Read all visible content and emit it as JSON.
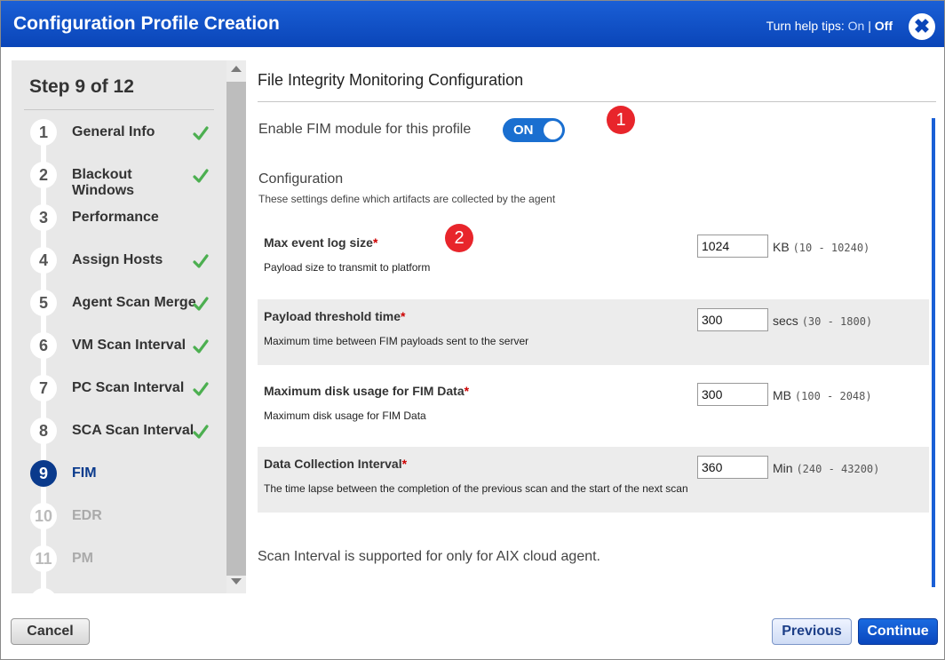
{
  "dialog": {
    "title": "Configuration Profile Creation",
    "help_prefix": "Turn help tips:",
    "help_on": "On",
    "help_sep": "|",
    "help_off": "Off",
    "close_glyph": "✖"
  },
  "sidebar": {
    "step_title": "Step 9 of 12",
    "steps": [
      {
        "num": "1",
        "label": "General Info",
        "state": "done"
      },
      {
        "num": "2",
        "label": "Blackout Windows",
        "state": "done"
      },
      {
        "num": "3",
        "label": "Performance",
        "state": "plain"
      },
      {
        "num": "4",
        "label": "Assign Hosts",
        "state": "done"
      },
      {
        "num": "5",
        "label": "Agent Scan Merge",
        "state": "done"
      },
      {
        "num": "6",
        "label": "VM Scan Interval",
        "state": "done"
      },
      {
        "num": "7",
        "label": "PC Scan Interval",
        "state": "done"
      },
      {
        "num": "8",
        "label": "SCA Scan Interval",
        "state": "done"
      },
      {
        "num": "9",
        "label": "FIM",
        "state": "active"
      },
      {
        "num": "10",
        "label": "EDR",
        "state": "disabled"
      },
      {
        "num": "11",
        "label": "PM",
        "state": "disabled"
      }
    ]
  },
  "main": {
    "title": "File Integrity Monitoring Configuration",
    "badge_1": "1",
    "badge_2": "2",
    "enable_label": "Enable FIM module for this profile",
    "toggle_text": "ON",
    "toggle_state": true,
    "config_heading": "Configuration",
    "config_sub": "These settings define which artifacts are collected by the agent",
    "rows": [
      {
        "name": "Max event log size",
        "req": "*",
        "desc": "Payload size to transmit to platform",
        "value": "1024",
        "unit": "KB",
        "range": "(10 - 10240)"
      },
      {
        "name": "Payload threshold time",
        "req": "*",
        "desc": "Maximum time between FIM payloads sent to the server",
        "value": "300",
        "unit": "secs",
        "range": "(30 - 1800)"
      },
      {
        "name": "Maximum disk usage for FIM Data",
        "req": "*",
        "desc": "Maximum disk usage for FIM Data",
        "value": "300",
        "unit": "MB",
        "range": "(100 - 2048)"
      },
      {
        "name": "Data Collection Interval",
        "req": "*",
        "desc": "The time lapse between the completion of the previous scan and the start of the next scan",
        "value": "360",
        "unit": "Min",
        "range": "(240 - 43200)"
      }
    ],
    "note": "Scan Interval is supported for only for AIX cloud agent."
  },
  "footer": {
    "cancel": "Cancel",
    "previous": "Previous",
    "continue": "Continue"
  },
  "colors": {
    "header_blue": "#0a45b8",
    "active_step": "#0a3a8c",
    "required_red": "#cc0000",
    "badge_red": "#e8252b",
    "check_green": "#4caf50"
  }
}
